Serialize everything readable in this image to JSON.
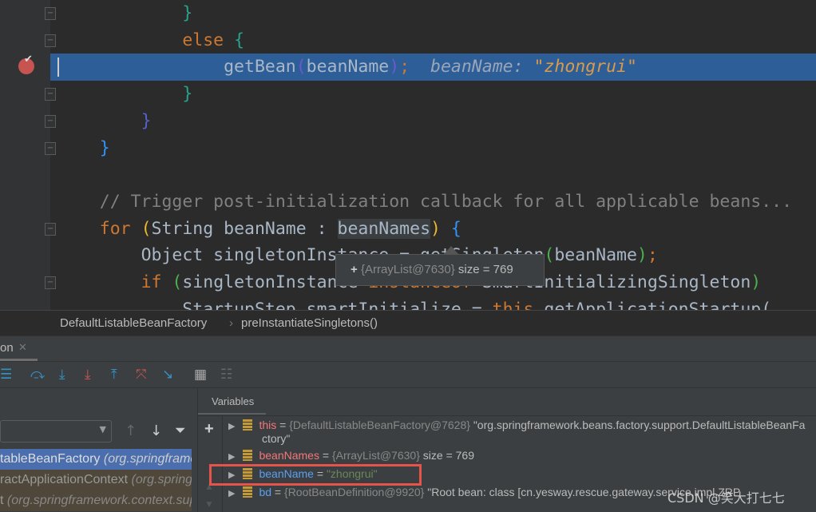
{
  "editor": {
    "lines": [
      {
        "indent": "            ",
        "parts": [
          {
            "t": "}",
            "c": "#2aa18b"
          }
        ]
      },
      {
        "indent": "            ",
        "parts": [
          {
            "t": "else ",
            "c": "#cc7832"
          },
          {
            "t": "{",
            "c": "#2aa18b"
          }
        ]
      },
      {
        "indent": "                ",
        "parts": [
          {
            "t": "getBean",
            "c": "#a9b7c6"
          },
          {
            "t": "(",
            "c": "#6a5acd"
          },
          {
            "t": "beanName",
            "c": "#a9b7c6"
          },
          {
            "t": ")",
            "c": "#6a5acd"
          },
          {
            "t": ";",
            "c": "#cc7832"
          }
        ]
      },
      {
        "indent": "            ",
        "parts": [
          {
            "t": "}",
            "c": "#2aa18b"
          }
        ]
      },
      {
        "indent": "        ",
        "parts": [
          {
            "t": "}",
            "c": "#5561c8"
          }
        ]
      },
      {
        "indent": "    ",
        "parts": [
          {
            "t": "}",
            "c": "#3592f4"
          }
        ]
      },
      {
        "indent": "",
        "parts": []
      },
      {
        "indent": "    ",
        "parts": [
          {
            "t": "// Trigger post-initialization callback for all applicable beans...",
            "c": "#808080"
          }
        ]
      },
      {
        "indent": "    ",
        "parts": [
          {
            "t": "for ",
            "c": "#cc7832"
          },
          {
            "t": "(",
            "c": "#e8b92c"
          },
          {
            "t": "String beanName : ",
            "c": "#a9b7c6"
          },
          {
            "t": "beanNames",
            "c": "#a9b7c6",
            "sel": true
          },
          {
            "t": ")",
            "c": "#e8b92c"
          },
          {
            "t": " {",
            "c": "#3592f4"
          }
        ]
      },
      {
        "indent": "        ",
        "parts": [
          {
            "t": "Object singletonInstance = getSingleton",
            "c": "#a9b7c6"
          },
          {
            "t": "(",
            "c": "#4caf50"
          },
          {
            "t": "beanName",
            "c": "#a9b7c6"
          },
          {
            "t": ")",
            "c": "#4caf50"
          },
          {
            "t": ";",
            "c": "#cc7832"
          }
        ]
      },
      {
        "indent": "        ",
        "parts": [
          {
            "t": "if ",
            "c": "#cc7832"
          },
          {
            "t": "(",
            "c": "#4caf50"
          },
          {
            "t": "singletonInstance ",
            "c": "#a9b7c6"
          },
          {
            "t": "instanceof ",
            "c": "#cc7832"
          },
          {
            "t": "SmartInitializingSingleton",
            "c": "#a9b7c6"
          },
          {
            "t": ")",
            "c": "#4caf50"
          }
        ]
      },
      {
        "indent": "            ",
        "parts": [
          {
            "t": "StartupStep smartInitialize = ",
            "c": "#a9b7c6"
          },
          {
            "t": "this",
            "c": "#cc7832"
          },
          {
            "t": ".getApplicationStartup(",
            "c": "#a9b7c6"
          }
        ]
      }
    ],
    "inline_hint": {
      "name": "beanName:",
      "value": "\"zhongrui\""
    },
    "tooltip": {
      "plus": "+",
      "type": "{ArrayList@7630}",
      "size": "size = 769"
    }
  },
  "breadcrumb": {
    "class": "DefaultListableBeanFactory",
    "sep": "›",
    "method": "preInstantiateSingletons()"
  },
  "debug_tab": {
    "label": "on",
    "close": "✕"
  },
  "frames": [
    {
      "name": "tableBeanFactory",
      "pkg": "(org.springframework.beans.factory.support)"
    },
    {
      "name": "ractApplicationContext",
      "pkg": "(org.springframework.context.support)"
    },
    {
      "name": "t",
      "pkg": "(org.springframework.context.support)"
    }
  ],
  "variables": {
    "tab": "Variables",
    "rows": [
      {
        "name": "this",
        "eq": " = ",
        "type": "{DefaultListableBeanFactory@7628}",
        "val": " \"org.springframework.beans.factory.support.DefaultListableBeanFactory\""
      },
      {
        "name": "beanNames",
        "eq": " = ",
        "type": "{ArrayList@7630}",
        "val": "  size = 769"
      },
      {
        "name": "beanName",
        "eq": " = ",
        "type": "",
        "val": "\"zhongrui\""
      },
      {
        "name": "bd",
        "eq": " = ",
        "type": "{RootBeanDefinition@9920}",
        "val": " \"Root bean: class [cn.yesway.rescue.gateway.service.impl.ZRP"
      }
    ]
  },
  "watermark": "CSDN @笑大打七七",
  "colors": {
    "highlight": "#2d5e98",
    "breakpoint": "#c75450",
    "selected_frame": "#4b6eaf",
    "highlight_box": "#e5544b"
  }
}
